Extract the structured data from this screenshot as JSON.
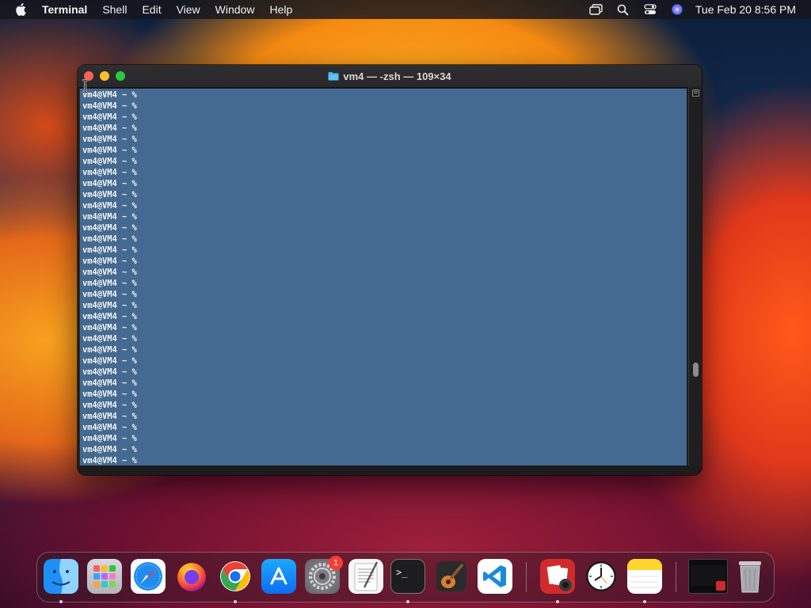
{
  "menubar": {
    "apple_icon": "apple-logo-icon",
    "app_name": "Terminal",
    "items": [
      "Shell",
      "Edit",
      "View",
      "Window",
      "Help"
    ],
    "status_icons": [
      "screen-mirroring-icon",
      "search-icon",
      "control-center-icon",
      "siri-icon"
    ],
    "clock": "Tue Feb 20  8:56 PM"
  },
  "terminal": {
    "title": "vm4 — -zsh — 109×34",
    "title_icon": "folder-icon",
    "prompt": "vm4@VM4 ~ %",
    "line_count": 34,
    "background_color": "#456a91",
    "text_color": "#f4f4f4"
  },
  "dock": {
    "apps": [
      {
        "name": "Finder",
        "icon": "finder-icon",
        "running": true
      },
      {
        "name": "Launchpad",
        "icon": "launchpad-icon",
        "running": false
      },
      {
        "name": "Safari",
        "icon": "safari-icon",
        "running": false
      },
      {
        "name": "Firefox",
        "icon": "firefox-icon",
        "running": false
      },
      {
        "name": "Google Chrome",
        "icon": "chrome-icon",
        "running": true
      },
      {
        "name": "App Store",
        "icon": "app-store-icon",
        "running": false
      },
      {
        "name": "System Settings",
        "icon": "settings-icon",
        "running": false,
        "badge": "1"
      },
      {
        "name": "TextEdit",
        "icon": "textedit-icon",
        "running": false
      },
      {
        "name": "Terminal",
        "icon": "terminal-icon",
        "running": true
      },
      {
        "name": "GarageBand",
        "icon": "garageband-icon",
        "running": false
      },
      {
        "name": "Visual Studio Code",
        "icon": "vscode-icon",
        "running": false
      },
      {
        "name": "Photo Booth",
        "icon": "photo-booth-icon",
        "running": true
      },
      {
        "name": "Clock",
        "icon": "clock-icon",
        "running": false
      },
      {
        "name": "Notes",
        "icon": "notes-icon",
        "running": true
      },
      {
        "name": "Screen Recording",
        "icon": "window-thumbnail-icon",
        "running": false
      },
      {
        "name": "Trash",
        "icon": "trash-icon",
        "running": false
      }
    ],
    "settings_badge": "1"
  }
}
